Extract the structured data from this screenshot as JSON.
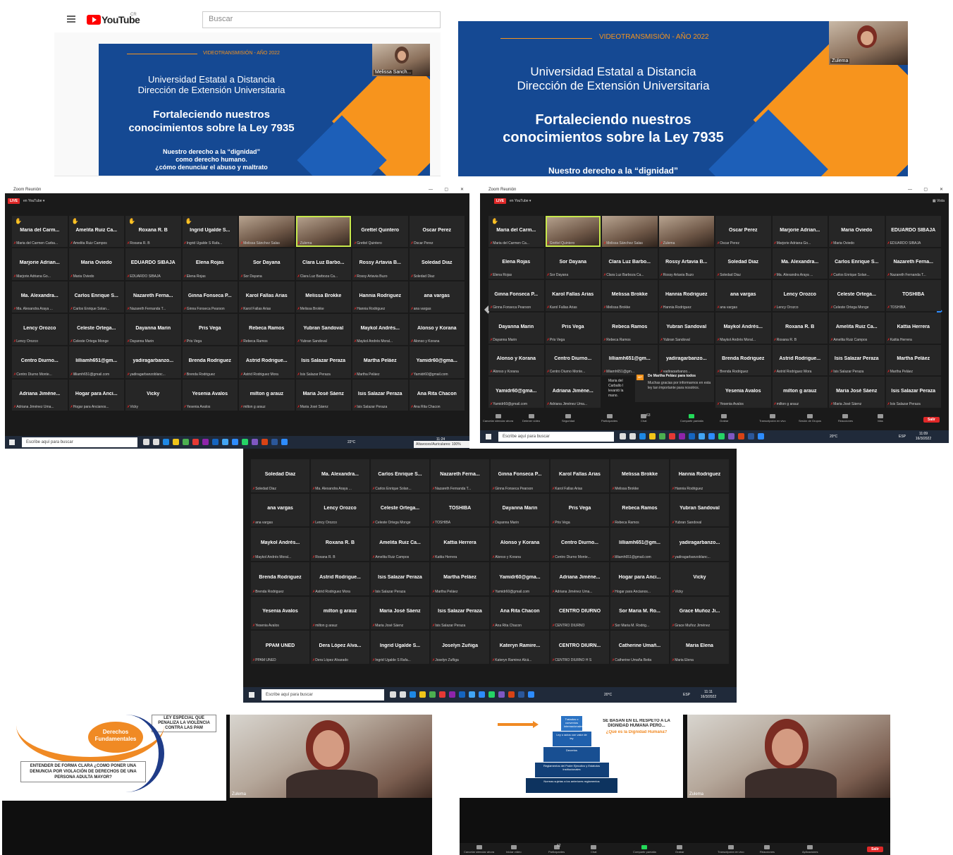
{
  "youtube": {
    "logo_text": "YouTube",
    "region": "CR",
    "search_placeholder": "Buscar"
  },
  "banner": {
    "kicker": "VIDEOTRANSMISIÓN - AÑO 2022",
    "line1": "Universidad Estatal a Distancia",
    "line2": "Dirección de Extensión Universitaria",
    "title1": "Fortaleciendo nuestros",
    "title2": "conocimientos sobre la Ley 7935",
    "sub1": "Nuestro derecho a la “dignidad”",
    "sub2": "como derecho humano.",
    "sub3": "¿cómo denunciar el abuso y maltrato"
  },
  "speakers": {
    "left": "Melissa Sanch...",
    "right": "Zulema"
  },
  "zoom": {
    "window_title": "Zoom Reunión",
    "live_badge": "LIVE",
    "live_on": "en YouTube ▾",
    "view_label": "▦ Vista",
    "chat_from": "De Martha Peláez para todos",
    "chat_msg": "Muchas gracias por informarnos en esta ley tan importante para nosotros.",
    "chat_tile": "Maria del Carballo l levantó la mano.",
    "toolbar": [
      "Cancelar silenciar ahora",
      "Detener vídeo",
      "Seguridad",
      "Participantes",
      "Chat",
      "Compartir pantalla",
      "Grabar",
      "Transcripción en vivo",
      "Sesión de Grupos",
      "Reacciones",
      "Más"
    ],
    "participants_count": "63",
    "exit_label": "Salir",
    "bottom_toolbar": [
      "Cancelar silenciar ahora",
      "Iniciar vídeo",
      "Participantes",
      "Chat",
      "Compartir pantalla",
      "Grabar",
      "Transcripción en vivo",
      "Reacciones",
      "Aplicaciones"
    ],
    "bottom_participants": "62"
  },
  "taskbar": {
    "search_placeholder": "Escribe aquí para buscar",
    "weather_a": "22°C",
    "weather_b": "20°C",
    "time_a": "11:24",
    "audio_tip": "Altavoces/Auriculares: 100%",
    "time_b": "11:09",
    "date_b": "16/3/2022",
    "time_c": "11:11",
    "date_c": "16/3/2022",
    "lang": "ESP"
  },
  "grid_left": [
    [
      "Maria del Carm...",
      "Maria del Carmen Carba...",
      1
    ],
    [
      "Amelita Ruiz Ca...",
      "Amelita Ruiz Campos",
      1
    ],
    [
      "Roxana R. B",
      "Roxana R. B",
      1
    ],
    [
      "Ingrid Ugalde S...",
      "Ingrid Ugalde S Rafa...",
      1
    ],
    [
      "",
      "Melissa Sánchez Salas",
      2
    ],
    [
      "",
      "Zulema",
      3
    ],
    [
      "Grettel Quintero",
      "Grettel Quintero",
      0
    ],
    [
      "Oscar Perez",
      "Oscar Perez",
      0
    ],
    [
      "Marjorie Adrian...",
      "Marjorie Adriana Go...",
      0
    ],
    [
      "Maria Oviedo",
      "Maria Oviedo",
      0
    ],
    [
      "EDUARDO SIBAJA",
      "EDUARDO SIBAJA",
      0
    ],
    [
      "Elena Rojas",
      "Elena Rojas",
      0
    ],
    [
      "Sor Dayana",
      "Sor Dayana",
      0
    ],
    [
      "Clara Luz Barbo...",
      "Clara Luz Barboza Ca...",
      0
    ],
    [
      "Rossy Artavia B...",
      "Rossy Artavia Buzo",
      0
    ],
    [
      "Soledad Diaz",
      "Soledad Diaz",
      0
    ],
    [
      "Ma. Alexandra...",
      "Ma. Alexandra Araya ...",
      0
    ],
    [
      "Carlos Enrique S...",
      "Carlos Enrique Solan...",
      0
    ],
    [
      "Nazareth Ferna...",
      "Nazareth Fernanda T...",
      0
    ],
    [
      "Ginna Fonseca P...",
      "Ginna Fonseca Pearson",
      0
    ],
    [
      "Karol Fallas Arias",
      "Karol Fallas Arias",
      0
    ],
    [
      "Melissa Brokke",
      "Melissa Brokke",
      0
    ],
    [
      "Hannia Rodriguez",
      "Hannia Rodriguez",
      0
    ],
    [
      "ana vargas",
      "ana vargas",
      0
    ],
    [
      "Lency Orozco",
      "Lency Orozco",
      0
    ],
    [
      "Celeste Ortega...",
      "Celeste Ortega Monge",
      0
    ],
    [
      "Dayanna Marin",
      "Dayanna Marin",
      0
    ],
    [
      "Pris Vega",
      "Pris Vega",
      0
    ],
    [
      "Rebeca Ramos",
      "Rebeca Ramos",
      0
    ],
    [
      "Yubran Sandoval",
      "Yubran Sandoval",
      0
    ],
    [
      "Maykol Andrés...",
      "Maykol Andrés Moral...",
      0
    ],
    [
      "Alonso y Korana",
      "Alonso y Korana",
      0
    ],
    [
      "Centro Diurno...",
      "Centro Diurno Monte...",
      0
    ],
    [
      "lilliamh651@gm...",
      "lilliamh651@gmail.com",
      0
    ],
    [
      "yadiragarbanzo...",
      "yadiragarbanzoblanc...",
      0
    ],
    [
      "Brenda Rodriguez",
      "Brenda Rodriguez",
      0
    ],
    [
      "Astrid Rodrigue...",
      "Astrid Rodriguez Mora",
      0
    ],
    [
      "Isis Salazar Peraza",
      "Isis Salazar Peraza",
      0
    ],
    [
      "Martha Peláez",
      "Martha Peláez",
      0
    ],
    [
      "Yamidr60@gma...",
      "Yamidr60@gmail.com",
      0
    ],
    [
      "Adriana Jiméne...",
      "Adriana Jiménez Uma...",
      0
    ],
    [
      "Hogar para Anci...",
      "Hogar para Ancianos...",
      0
    ],
    [
      "Vicky",
      "Vicky",
      0
    ],
    [
      "Yesenia Avalos",
      "Yesenia Avalos",
      0
    ],
    [
      "milton g arauz",
      "milton g arauz",
      0
    ],
    [
      "Maria José Sáenz",
      "Maria José Sáenz",
      0
    ],
    [
      "Isis Salazar Peraza",
      "Isis Salazar Peraza",
      0
    ],
    [
      "Ana Rita Chacon",
      "Ana Rita Chacon",
      0
    ]
  ],
  "grid_right": [
    [
      "Maria del Carm...",
      "Maria del Carmen Ca...",
      1
    ],
    [
      "",
      "Grettel Quintero",
      3
    ],
    [
      "",
      "Melissa Sánchez Salas",
      2
    ],
    [
      "",
      "Zulema",
      2
    ],
    [
      "Oscar Perez",
      "Oscar Perez",
      0
    ],
    [
      "Marjorie Adrian...",
      "Marjorie Adriana Go...",
      0
    ],
    [
      "Maria Oviedo",
      "Maria Oviedo",
      0
    ],
    [
      "EDUARDO SIBAJA",
      "EDUARDO SIBAJA",
      0
    ],
    [
      "Elena Rojas",
      "Elena Rojas",
      0
    ],
    [
      "Sor Dayana",
      "Sor Dayana",
      0
    ],
    [
      "Clara Luz Barbo...",
      "Clara Luz Barboza Ca...",
      0
    ],
    [
      "Rossy Artavia B...",
      "Rossy Artavia Buzo",
      0
    ],
    [
      "Soledad Diaz",
      "Soledad Diaz",
      0
    ],
    [
      "Ma. Alexandra...",
      "Ma. Alexandra Araya ...",
      0
    ],
    [
      "Carlos Enrique S...",
      "Carlos Enrique Solan...",
      0
    ],
    [
      "Nazareth Ferna...",
      "Nazareth Fernanda T...",
      0
    ],
    [
      "Ginna Fonseca P...",
      "Ginna Fonseca Pearson",
      0
    ],
    [
      "Karol Fallas Arias",
      "Karol Fallas Arias",
      0
    ],
    [
      "Melissa Brokke",
      "Melissa Brokke",
      0
    ],
    [
      "Hannia Rodriguez",
      "Hannia Rodriguez",
      0
    ],
    [
      "ana vargas",
      "ana vargas",
      0
    ],
    [
      "Lency Orozco",
      "Lency Orozco",
      0
    ],
    [
      "Celeste Ortega...",
      "Celeste Ortega Monge",
      0
    ],
    [
      "TOSHIBA",
      "TOSHIBA",
      0
    ],
    [
      "Dayanna Marin",
      "Dayanna Marin",
      0
    ],
    [
      "Pris Vega",
      "Pris Vega",
      0
    ],
    [
      "Rebeca Ramos",
      "Rebeca Ramos",
      0
    ],
    [
      "Yubran Sandoval",
      "Yubran Sandoval",
      0
    ],
    [
      "Maykol Andrés...",
      "Maykol Andrés Moral...",
      0
    ],
    [
      "Roxana R. B",
      "Roxana R. B",
      0
    ],
    [
      "Amelita Ruiz Ca...",
      "Amelita Ruiz Campos",
      0
    ],
    [
      "Kattia Herrera",
      "Kattia Herrera",
      0
    ],
    [
      "Alonso y Korana",
      "Alonso y Korana",
      0
    ],
    [
      "Centro Diurno...",
      "Centro Diurno Monte...",
      0
    ],
    [
      "lilliamh651@gm...",
      "lilliamh651@gm...",
      0
    ],
    [
      "yadiragarbanzo...",
      "yadiragarbanzo...",
      0
    ],
    [
      "Brenda Rodriguez",
      "Brenda Rodriguez",
      0
    ],
    [
      "Astrid Rodrigue...",
      "Astrid Rodriguez Mora",
      0
    ],
    [
      "Isis Salazar Peraza",
      "Isis Salazar Peraza",
      0
    ],
    [
      "Martha Peláez",
      "Martha Peláez",
      0
    ],
    [
      "Yamidr60@gma...",
      "Yamidr60@gmail.com",
      0
    ],
    [
      "Adriana Jiméne...",
      "Adriana Jiménez Uma...",
      0
    ],
    [
      "",
      "",
      4
    ],
    [
      "",
      "",
      4
    ],
    [
      "Yesenia Avalos",
      "Yesenia Avalos",
      0
    ],
    [
      "milton g arauz",
      "milton g arauz",
      0
    ],
    [
      "Maria José Sáenz",
      "Maria José Sáenz",
      0
    ],
    [
      "Isis Salazar Peraza",
      "Isis Salazar Peraza",
      0
    ]
  ],
  "grid_center": [
    [
      "Soledad Diaz",
      "Soledad Diaz"
    ],
    [
      "Ma. Alexandra...",
      "Ma. Alexandra Araya ..."
    ],
    [
      "Carlos Enrique S...",
      "Carlos Enrique Solan..."
    ],
    [
      "Nazareth Ferna...",
      "Nazareth Fernanda T..."
    ],
    [
      "Ginna Fonseca P...",
      "Ginna Fonseca Pearson"
    ],
    [
      "Karol Fallas Arias",
      "Karol Fallas Arias"
    ],
    [
      "Melissa Brokke",
      "Melissa Brokke"
    ],
    [
      "Hannia Rodriguez",
      "Hannia Rodriguez"
    ],
    [
      "ana vargas",
      "ana vargas"
    ],
    [
      "Lency Orozco",
      "Lency Orozco"
    ],
    [
      "Celeste Ortega...",
      "Celeste Ortega Monge"
    ],
    [
      "TOSHIBA",
      "TOSHIBA"
    ],
    [
      "Dayanna Marin",
      "Dayanna Marin"
    ],
    [
      "Pris Vega",
      "Pris Vega"
    ],
    [
      "Rebeca Ramos",
      "Rebeca Ramos"
    ],
    [
      "Yubran Sandoval",
      "Yubran Sandoval"
    ],
    [
      "Maykol Andrés...",
      "Maykol Andrés Moral..."
    ],
    [
      "Roxana R. B",
      "Roxana R. B"
    ],
    [
      "Amelita Ruiz Ca...",
      "Amelita Ruiz Campos"
    ],
    [
      "Kattia Herrera",
      "Kattia Herrera"
    ],
    [
      "Alonso y Korana",
      "Alonso y Korana"
    ],
    [
      "Centro Diurno...",
      "Centro Diurno Monte..."
    ],
    [
      "lilliamh651@gm...",
      "lilliamh651@gmail.com"
    ],
    [
      "yadiragarbanzo...",
      "yadiragarbanzoblanc..."
    ],
    [
      "Brenda Rodriguez",
      "Brenda Rodriguez"
    ],
    [
      "Astrid Rodrigue...",
      "Astrid Rodriguez Mora"
    ],
    [
      "Isis Salazar Peraza",
      "Isis Salazar Peraza"
    ],
    [
      "Martha Peláez",
      "Martha Peláez"
    ],
    [
      "Yamidr60@gma...",
      "Yamidr60@gmail.com"
    ],
    [
      "Adriana Jiméne...",
      "Adriana Jiménez Uma..."
    ],
    [
      "Hogar para Anci...",
      "Hogar para Ancianos..."
    ],
    [
      "Vicky",
      "Vicky"
    ],
    [
      "Yesenia Avalos",
      "Yesenia Avalos"
    ],
    [
      "milton g arauz",
      "milton g arauz"
    ],
    [
      "Maria José Sáenz",
      "Maria José Sáenz"
    ],
    [
      "Isis Salazar Peraza",
      "Isis Salazar Peraza"
    ],
    [
      "Ana Rita Chacon",
      "Ana Rita Chacon"
    ],
    [
      "CENTRO DIURNO",
      "CENTRO DIURNO"
    ],
    [
      "Sor Maria M. Ro...",
      "Sor Maria M. Rodrig..."
    ],
    [
      "Grace Muñoz Ji...",
      "Grace Muñoz Jiménez"
    ],
    [
      "PPAM UNED",
      "PPAM UNED"
    ],
    [
      "Dera López Alva...",
      "Dera López Alvarado"
    ],
    [
      "Ingrid Ugalde S...",
      "Ingrid Ugalde S Rafa..."
    ],
    [
      "Joselyn Zuñiga",
      "Joselyn Zuñiga"
    ],
    [
      "Kateryn Ramire...",
      "Kateryn Ramirez Alcá..."
    ],
    [
      "CENTRO DIURN...",
      "CENTRO DIURNO H S"
    ],
    [
      "Catherine Umañ...",
      "Catherine Umaña Beita"
    ],
    [
      "Maria Elena",
      "Maria Elena"
    ]
  ],
  "slide_left": {
    "law_title": "LEY ESPECIAL QUE PENALIZA LA VIOLENCIA CONTRA LAS PAM",
    "bubble": "Derechos Fundamentales",
    "box": "ENTENDER DE FORMA CLARA ¿COMO PONER UNA DENUNCIA POR VIOLACIÓN DE DERECHOS DE UNA PERSONA ADULTA MAYOR?",
    "cam_name": "Zulema"
  },
  "slide_right": {
    "heading": "SE BASAN EN EL RESPETO A LA DIGNIDAD HUMANA PERO...",
    "question": "¿Qué es la Dignidad Humana?",
    "pyramid": [
      "Tratados o convenios internacionales",
      "Ley o actos con valor de ley",
      "Decretos",
      "Reglamentos del Poder Ejecutivo y Estatutos Institucionales",
      "Normas sujetas a los anteriores reglamentos"
    ],
    "cam_name": "Zulema"
  }
}
